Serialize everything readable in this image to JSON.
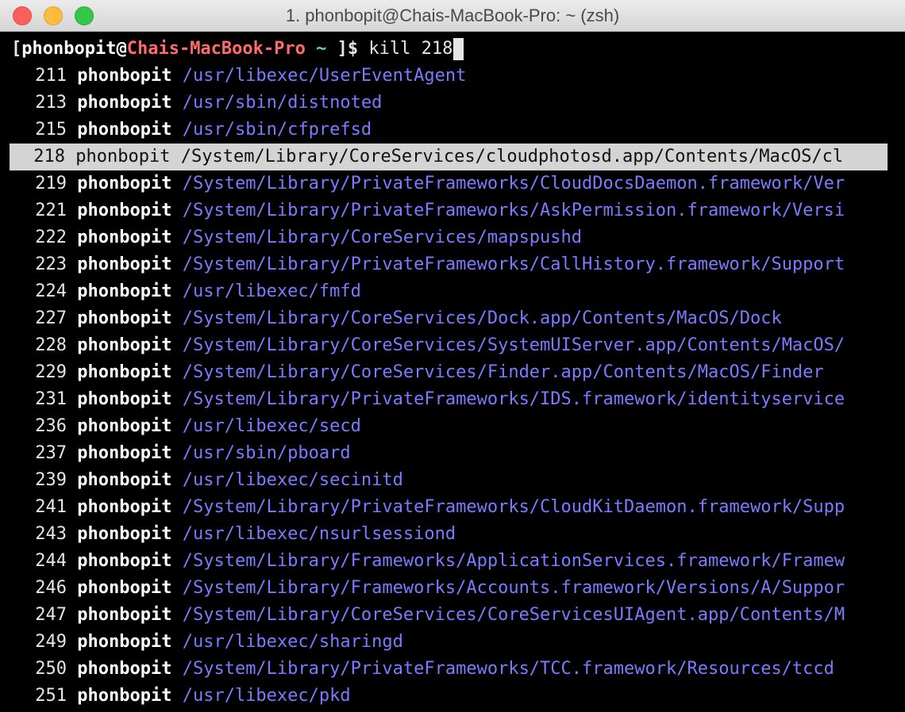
{
  "window": {
    "title": "1. phonbopit@Chais-MacBook-Pro: ~ (zsh)"
  },
  "prompt": {
    "open_bracket": "[",
    "user": "phonbopit",
    "at": "@",
    "host": "Chais-MacBook-Pro",
    "cwd": "~",
    "close": " ]$ ",
    "command": "kill 218"
  },
  "processes": [
    {
      "pid": "211",
      "user": "phonbopit",
      "path": "/usr/libexec/UserEventAgent"
    },
    {
      "pid": "213",
      "user": "phonbopit",
      "path": "/usr/sbin/distnoted"
    },
    {
      "pid": "215",
      "user": "phonbopit",
      "path": "/usr/sbin/cfprefsd"
    },
    {
      "pid": "218",
      "user": "phonbopit",
      "path": "/System/Library/CoreServices/cloudphotosd.app/Contents/MacOS/cl"
    },
    {
      "pid": "219",
      "user": "phonbopit",
      "path": "/System/Library/PrivateFrameworks/CloudDocsDaemon.framework/Ver"
    },
    {
      "pid": "221",
      "user": "phonbopit",
      "path": "/System/Library/PrivateFrameworks/AskPermission.framework/Versi"
    },
    {
      "pid": "222",
      "user": "phonbopit",
      "path": "/System/Library/CoreServices/mapspushd"
    },
    {
      "pid": "223",
      "user": "phonbopit",
      "path": "/System/Library/PrivateFrameworks/CallHistory.framework/Support"
    },
    {
      "pid": "224",
      "user": "phonbopit",
      "path": "/usr/libexec/fmfd"
    },
    {
      "pid": "227",
      "user": "phonbopit",
      "path": "/System/Library/CoreServices/Dock.app/Contents/MacOS/Dock"
    },
    {
      "pid": "228",
      "user": "phonbopit",
      "path": "/System/Library/CoreServices/SystemUIServer.app/Contents/MacOS/"
    },
    {
      "pid": "229",
      "user": "phonbopit",
      "path": "/System/Library/CoreServices/Finder.app/Contents/MacOS/Finder"
    },
    {
      "pid": "231",
      "user": "phonbopit",
      "path": "/System/Library/PrivateFrameworks/IDS.framework/identityservice"
    },
    {
      "pid": "236",
      "user": "phonbopit",
      "path": "/usr/libexec/secd"
    },
    {
      "pid": "237",
      "user": "phonbopit",
      "path": "/usr/sbin/pboard"
    },
    {
      "pid": "239",
      "user": "phonbopit",
      "path": "/usr/libexec/secinitd"
    },
    {
      "pid": "241",
      "user": "phonbopit",
      "path": "/System/Library/PrivateFrameworks/CloudKitDaemon.framework/Supp"
    },
    {
      "pid": "243",
      "user": "phonbopit",
      "path": "/usr/libexec/nsurlsessiond"
    },
    {
      "pid": "244",
      "user": "phonbopit",
      "path": "/System/Library/Frameworks/ApplicationServices.framework/Framew"
    },
    {
      "pid": "246",
      "user": "phonbopit",
      "path": "/System/Library/Frameworks/Accounts.framework/Versions/A/Suppor"
    },
    {
      "pid": "247",
      "user": "phonbopit",
      "path": "/System/Library/CoreServices/CoreServicesUIAgent.app/Contents/M"
    },
    {
      "pid": "249",
      "user": "phonbopit",
      "path": "/usr/libexec/sharingd"
    },
    {
      "pid": "250",
      "user": "phonbopit",
      "path": "/System/Library/PrivateFrameworks/TCC.framework/Resources/tccd"
    },
    {
      "pid": "251",
      "user": "phonbopit",
      "path": "/usr/libexec/pkd"
    }
  ],
  "selected_pid": "218",
  "colors": {
    "background": "#000000",
    "path": "#7b7bff",
    "host": "#ff6b6b",
    "selection": "#d4d4d4"
  }
}
